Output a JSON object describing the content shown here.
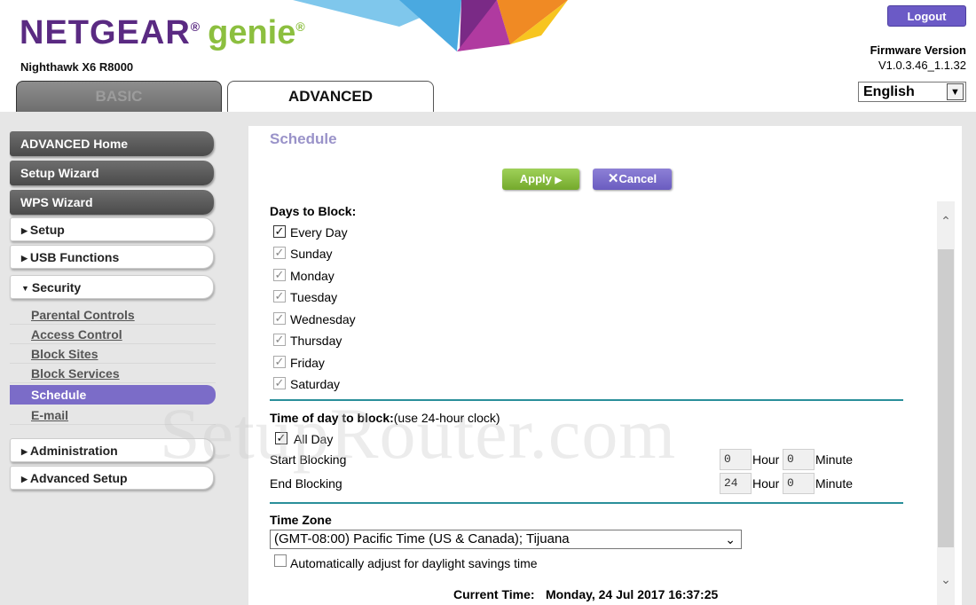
{
  "header": {
    "brand_name": "NETGEAR",
    "brand_reg": "®",
    "brand_genie": "genie",
    "genie_reg": "®",
    "model": "Nighthawk X6 R8000",
    "logout_label": "Logout",
    "firmware_label": "Firmware Version",
    "firmware_value": "V1.0.3.46_1.1.32",
    "language": "English"
  },
  "tabs": [
    {
      "label": "BASIC",
      "active": false
    },
    {
      "label": "ADVANCED",
      "active": true
    }
  ],
  "sidebar": {
    "top_items": [
      "ADVANCED Home",
      "Setup Wizard",
      "WPS Wizard"
    ],
    "sections": [
      "Setup",
      "USB Functions",
      "Security",
      "Administration",
      "Advanced Setup"
    ],
    "security_sub": [
      "Parental Controls",
      "Access Control",
      "Block Sites",
      "Block Services",
      "Schedule",
      "E-mail"
    ],
    "active_sub": "Schedule"
  },
  "page": {
    "title": "Schedule",
    "apply_label": "Apply",
    "cancel_label": "Cancel",
    "days_heading": "Days to Block:",
    "days": [
      {
        "label": "Every Day",
        "checked": true
      },
      {
        "label": "Sunday",
        "checked": true
      },
      {
        "label": "Monday",
        "checked": true
      },
      {
        "label": "Tuesday",
        "checked": true
      },
      {
        "label": "Wednesday",
        "checked": true
      },
      {
        "label": "Thursday",
        "checked": true
      },
      {
        "label": "Friday",
        "checked": true
      },
      {
        "label": "Saturday",
        "checked": true
      }
    ],
    "time_heading": "Time of day to block:",
    "time_note": "(use 24-hour clock)",
    "all_day_label": "All Day",
    "start_label": "Start Blocking",
    "end_label": "End Blocking",
    "start_hour": "0",
    "start_minute": "0",
    "end_hour": "24",
    "end_minute": "0",
    "hour_label": "Hour",
    "minute_label": "Minute",
    "tz_heading": "Time Zone",
    "tz_value": "(GMT-08:00) Pacific Time (US & Canada); Tijuana",
    "dst_label": "Automatically adjust for daylight savings time",
    "current_time_label": "Current Time:",
    "current_time_value": "Monday, 24 Jul 2017 16:37:25"
  },
  "watermark": "SetupRouter.com"
}
